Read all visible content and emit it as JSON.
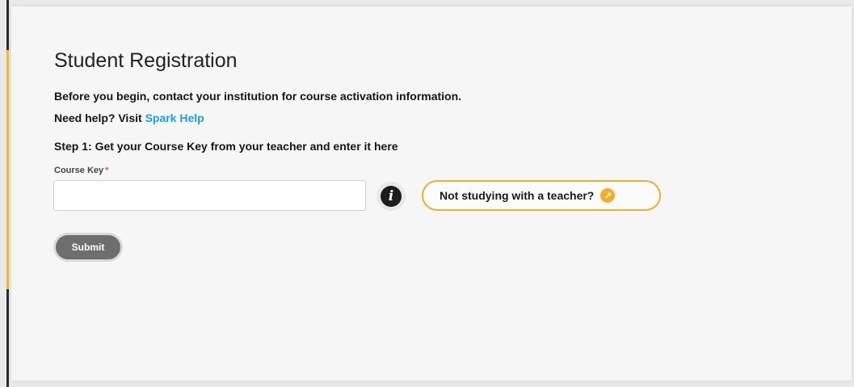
{
  "page": {
    "title": "Student Registration",
    "intro": "Before you begin, contact your institution for course activation information.",
    "help_prefix": "Need help? Visit",
    "help_link": "Spark Help",
    "step1": "Step 1: Get your Course Key from your teacher and enter it here"
  },
  "form": {
    "course_key_label": "Course Key",
    "required_marker": "*",
    "course_key_value": "",
    "info_icon": "info-icon",
    "info_glyph": "i",
    "teacher_button_label": "Not studying with a teacher?",
    "teacher_button_icon": "arrow-up-right-icon",
    "submit_label": "Submit"
  },
  "colors": {
    "accent": "#f2ad2a",
    "link": "#1a9fd6",
    "submit_bg": "#6e6e6e",
    "required": "#d9534f"
  }
}
